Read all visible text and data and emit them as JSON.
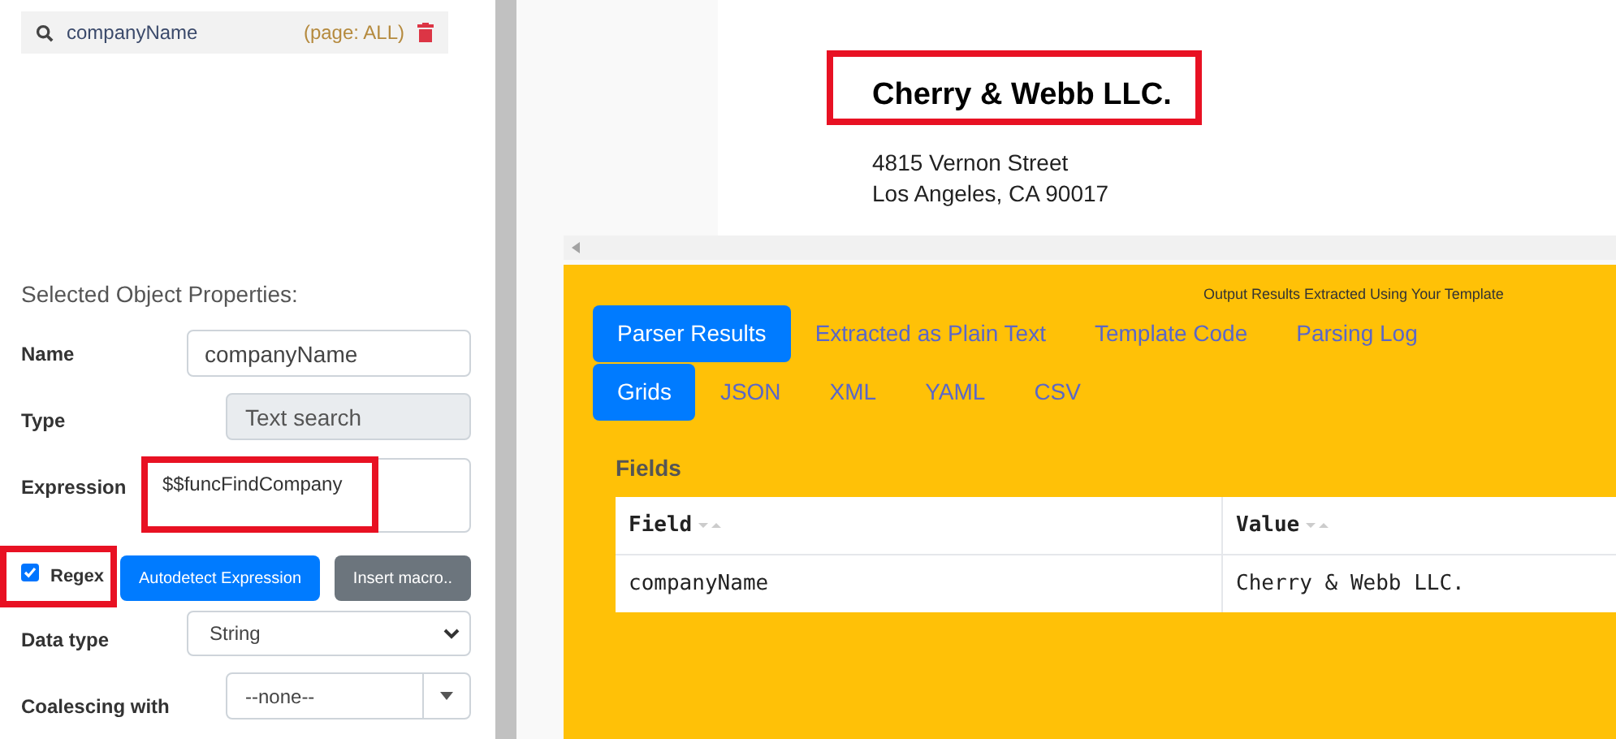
{
  "objects": [
    {
      "name": "companyName",
      "page": "(page: ALL)"
    }
  ],
  "properties": {
    "title": "Selected Object Properties:",
    "name": {
      "label": "Name",
      "value": "companyName"
    },
    "type": {
      "label": "Type",
      "value": "Text search",
      "disabled": true
    },
    "expression": {
      "label": "Expression",
      "value": "$$funcFindCompany",
      "highlighted": true
    },
    "regex": {
      "label": "Regex",
      "checked": true,
      "highlighted": true
    },
    "buttons": [
      {
        "label": "Autodetect Expression",
        "kind": "primary"
      },
      {
        "label": "Insert macro..",
        "kind": "secondary"
      }
    ],
    "data_type": {
      "label": "Data type",
      "value": "String"
    },
    "coalescing": {
      "label": "Coalescing with",
      "value": "--none--"
    }
  },
  "document": {
    "company": "Cherry & Webb LLC.",
    "company_highlighted": true,
    "address": [
      "4815 Vernon Street",
      "Los Angeles, CA 90017"
    ]
  },
  "results": {
    "caption": "Output Results Extracted Using Your Template",
    "tabs": [
      {
        "label": "Parser Results",
        "selected": true
      },
      {
        "label": "Extracted as Plain Text",
        "selected": false
      },
      {
        "label": "Template Code",
        "selected": false
      },
      {
        "label": "Parsing Log",
        "selected": false
      }
    ],
    "subtabs": [
      {
        "label": "Grids",
        "selected": true
      },
      {
        "label": "JSON",
        "selected": false
      },
      {
        "label": "XML",
        "selected": false
      },
      {
        "label": "YAML",
        "selected": false
      },
      {
        "label": "CSV",
        "selected": false
      }
    ],
    "section": "Fields",
    "table": {
      "columns": [
        "Field",
        "Value"
      ],
      "rows": [
        [
          "companyName",
          "Cherry & Webb LLC."
        ]
      ]
    }
  }
}
